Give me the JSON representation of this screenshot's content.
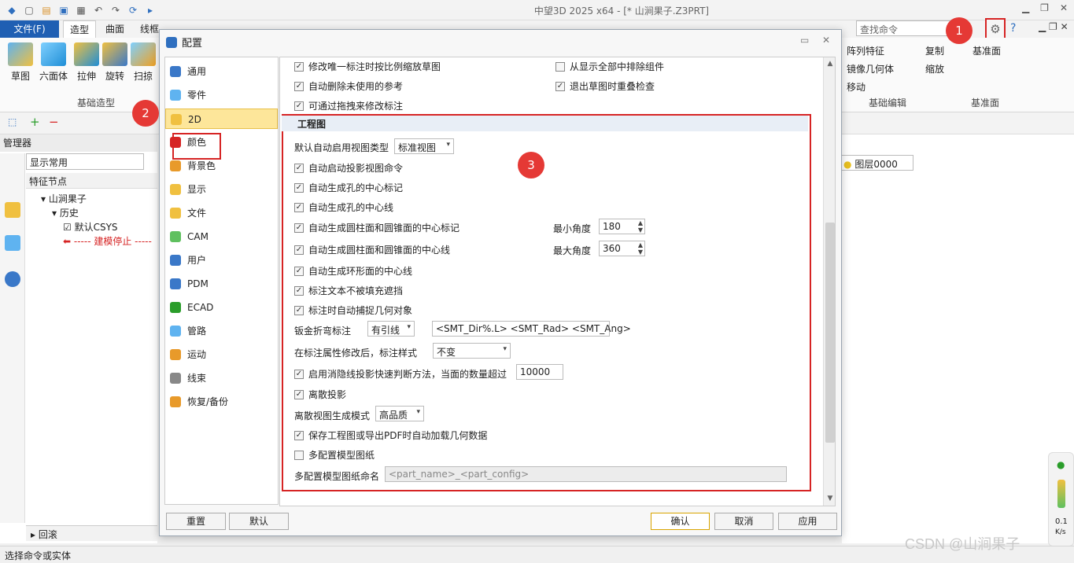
{
  "app": {
    "title": "中望3D 2025 x64 - [* 山涧果子.Z3PRT]",
    "search_placeholder": "查找命令",
    "status": "选择命令或实体",
    "watermark": "CSDN @山涧果子"
  },
  "ribbon": {
    "tabs": [
      "文件(F)",
      "造型",
      "曲面",
      "线框"
    ],
    "buttons": [
      "草图",
      "六面体",
      "拉伸",
      "旋转",
      "扫掠"
    ],
    "group_label": "基础造型",
    "right_items": [
      "阵列特征",
      "复制",
      "镜像几何体",
      "缩放",
      "移动",
      "基准面"
    ],
    "right_groups": [
      "基础编辑",
      "基准面"
    ]
  },
  "manager": {
    "title": "管理器",
    "combo": "显示常用",
    "feature_header": "特征节点",
    "tree": [
      "山涧果子",
      "历史",
      "默认CSYS",
      "----- 建模停止 -----"
    ],
    "bottom": "回滚"
  },
  "viewport": {
    "layer": "图层0000",
    "gauge_value": "0.1",
    "gauge_unit": "K/s"
  },
  "badges": [
    "1",
    "2",
    "3"
  ],
  "dialog": {
    "title": "配置",
    "nav": [
      "通用",
      "零件",
      "2D",
      "颜色",
      "背景色",
      "显示",
      "文件",
      "CAM",
      "用户",
      "PDM",
      "ECAD",
      "管路",
      "运动",
      "线束",
      "恢复/备份"
    ],
    "nav_active": "2D",
    "top_checks": [
      {
        "label": "修改唯一标注时按比例缩放草图",
        "checked": true
      },
      {
        "label": "从显示全部中排除组件",
        "checked": false
      },
      {
        "label": "自动删除未使用的参考",
        "checked": true
      },
      {
        "label": "退出草图时重叠检查",
        "checked": true
      },
      {
        "label": "可通过拖拽来修改标注",
        "checked": true
      }
    ],
    "section_title": "工程图",
    "default_view_label": "默认自动启用视图类型",
    "default_view_value": "标准视图",
    "checks": [
      {
        "label": "自动启动投影视图命令",
        "checked": true
      },
      {
        "label": "自动生成孔的中心标记",
        "checked": true
      },
      {
        "label": "自动生成孔的中心线",
        "checked": true
      },
      {
        "label": "自动生成圆柱面和圆锥面的中心标记",
        "checked": true
      },
      {
        "label": "自动生成圆柱面和圆锥面的中心线",
        "checked": true
      },
      {
        "label": "自动生成环形面的中心线",
        "checked": true
      },
      {
        "label": "标注文本不被填充遮挡",
        "checked": true
      },
      {
        "label": "标注时自动捕捉几何对象",
        "checked": true
      }
    ],
    "min_angle_label": "最小角度",
    "min_angle": "180",
    "max_angle_label": "最大角度",
    "max_angle": "360",
    "sheet_metal_label": "钣金折弯标注",
    "sheet_metal_value": "有引线",
    "sheet_metal_format": "<SMT_Dir%.L> <SMT_Rad> <SMT_Ang>",
    "dim_style_label": "在标注属性修改后，标注样式",
    "dim_style_value": "不变",
    "hidden_line_label": "启用消隐线投影快速判断方法，当面的数量超过",
    "hidden_line_checked": true,
    "hidden_line_value": "10000",
    "discrete_label": "离散投影",
    "discrete_checked": true,
    "discrete_mode_label": "离散视图生成模式",
    "discrete_mode_value": "高品质",
    "save_pdf_label": "保存工程图或导出PDF时自动加载几何数据",
    "save_pdf_checked": true,
    "multi_config_label": "多配置模型图纸",
    "multi_config_checked": false,
    "multi_name_label": "多配置模型图纸命名",
    "multi_name_value": "<part_name>_<part_config>",
    "buttons": {
      "reset": "重置",
      "default": "默认",
      "ok": "确认",
      "cancel": "取消",
      "apply": "应用"
    }
  },
  "colors": {
    "accent": "#1f5fb3",
    "highlight": "#d62424",
    "active_nav": "#fde69a"
  }
}
